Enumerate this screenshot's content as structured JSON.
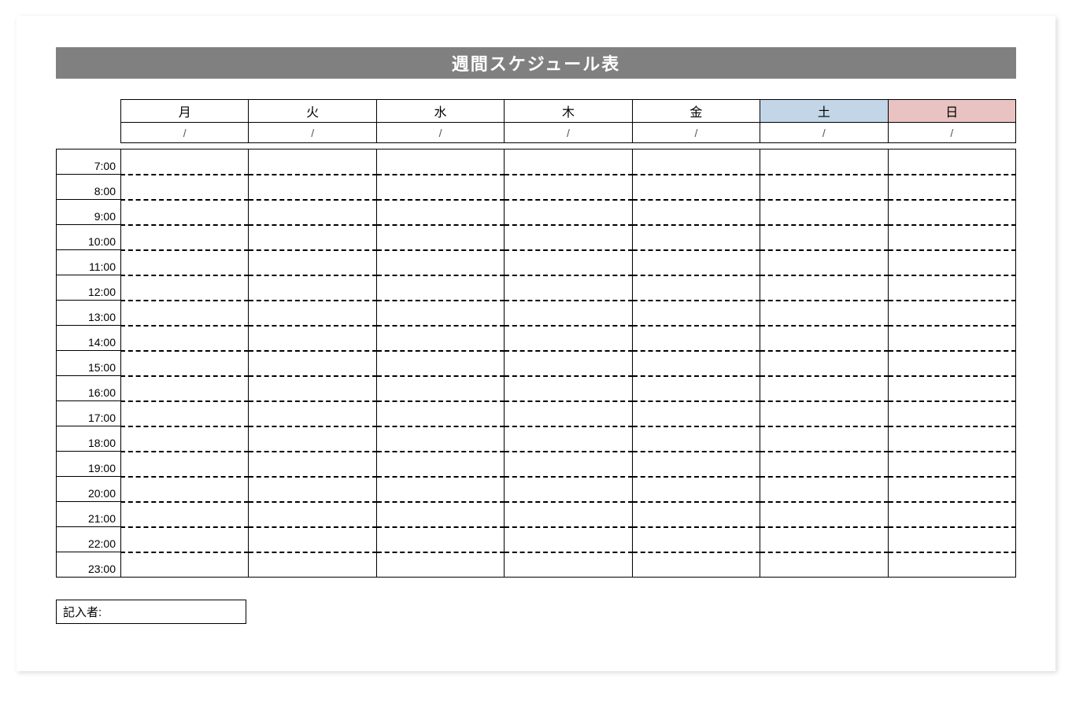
{
  "title": "週間スケジュール表",
  "days": [
    "月",
    "火",
    "水",
    "木",
    "金",
    "土",
    "日"
  ],
  "dates": [
    "/",
    "/",
    "/",
    "/",
    "/",
    "/",
    "/"
  ],
  "times": [
    "7:00",
    "8:00",
    "9:00",
    "10:00",
    "11:00",
    "12:00",
    "13:00",
    "14:00",
    "15:00",
    "16:00",
    "17:00",
    "18:00",
    "19:00",
    "20:00",
    "21:00",
    "22:00",
    "23:00"
  ],
  "writer_label": "記入者:",
  "colors": {
    "saturday": "#c2d6e8",
    "sunday": "#e9c2c2",
    "titlebar": "#808080"
  }
}
